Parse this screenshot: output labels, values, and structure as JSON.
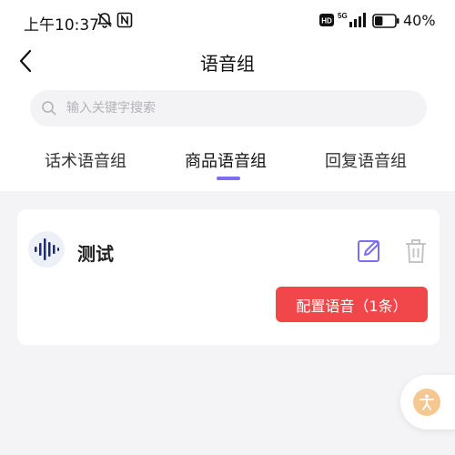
{
  "status_bar": {
    "time": "上午10:37",
    "network_label": "5G",
    "hd_label": "HD",
    "battery_percent": "40%",
    "battery_level": 0.4,
    "icons": [
      "mute-icon",
      "nfc-icon",
      "hd-icon",
      "signal-icon",
      "battery-icon"
    ]
  },
  "nav": {
    "title": "语音组",
    "back_icon": "chevron-left-icon"
  },
  "search": {
    "placeholder": "输入关键字搜索",
    "value": "",
    "icon": "search-icon"
  },
  "tabs": [
    {
      "label": "话术语音组",
      "active": false
    },
    {
      "label": "商品语音组",
      "active": true
    },
    {
      "label": "回复语音组",
      "active": false
    }
  ],
  "card": {
    "title": "测试",
    "icon": "voice-wave-icon",
    "config_button_label": "配置语音（1条）",
    "edit_icon": "edit-icon",
    "delete_icon": "trash-icon"
  },
  "floating": {
    "icon": "accessibility-icon"
  },
  "colors": {
    "accent": "#7b6ef0",
    "primary_button": "#f2474a",
    "avatar_wave": "#1f2d6b",
    "floating_icon_bg": "#f6c891"
  }
}
